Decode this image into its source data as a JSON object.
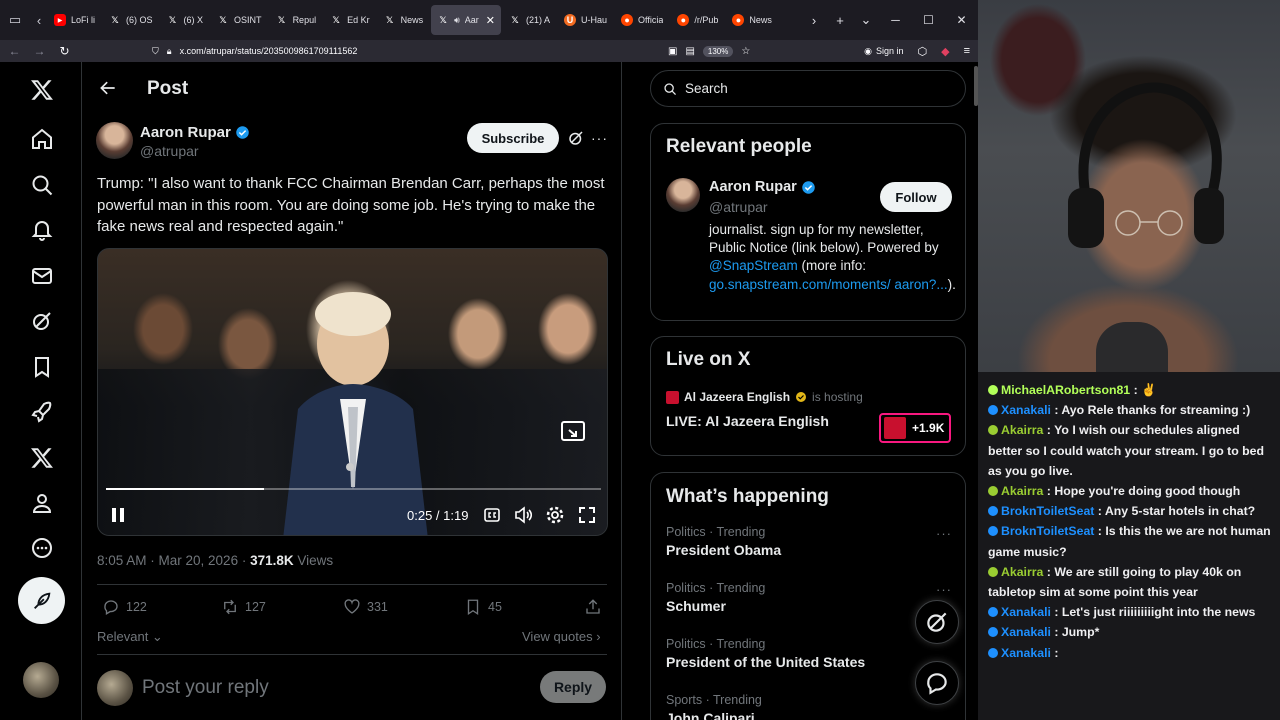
{
  "browser": {
    "tabs": [
      {
        "icon": "youtube-icon",
        "title": "LoFi li",
        "active": false
      },
      {
        "icon": "x-logo-icon",
        "title": "(6) OS",
        "active": false
      },
      {
        "icon": "x-logo-icon",
        "title": "(6) X",
        "active": false
      },
      {
        "icon": "x-logo-icon",
        "title": "OSINT",
        "active": false
      },
      {
        "icon": "x-logo-icon",
        "title": "Repul",
        "active": false
      },
      {
        "icon": "x-logo-icon",
        "title": "Ed Kr",
        "active": false
      },
      {
        "icon": "x-logo-icon",
        "title": "News",
        "active": false
      },
      {
        "icon": "x-logo-icon",
        "title": "Aar",
        "active": true
      },
      {
        "icon": "x-logo-icon",
        "title": "(21) A",
        "active": false
      },
      {
        "icon": "uhaul-icon",
        "title": "U-Hau",
        "active": false
      },
      {
        "icon": "reddit-icon",
        "title": "Officia",
        "active": false
      },
      {
        "icon": "reddit-icon",
        "title": "/r/Pub",
        "active": false
      },
      {
        "icon": "reddit-icon",
        "title": "News",
        "active": false
      }
    ],
    "url": "x.com/atrupar/status/2035009861709111562",
    "zoom": "130%",
    "sign_in": "Sign in"
  },
  "post": {
    "header_title": "Post",
    "author_name": "Aaron Rupar",
    "author_handle": "@atrupar",
    "subscribe_label": "Subscribe",
    "text": "Trump: \"I also want to thank FCC Chairman Brendan Carr, perhaps the most powerful man in this room. You are doing some job. He's trying to make the fake news real and respected again.\"",
    "video": {
      "time": "0:25 / 1:19",
      "progress": 0.32
    },
    "timestamp": "8:05 AM · Mar 20, 2026 · ",
    "views_count": "371.8K",
    "views_label": " Views",
    "replies": "122",
    "reposts": "127",
    "likes": "331",
    "bookmarks": "45",
    "sort_label": "Relevant",
    "view_quotes": "View quotes",
    "reply_placeholder": "Post your reply",
    "reply_button": "Reply"
  },
  "sidebar": {
    "search_placeholder": "Search",
    "relevant_title": "Relevant people",
    "rp_name": "Aaron Rupar",
    "rp_handle": "@atrupar",
    "follow_label": "Follow",
    "rp_bio_1": "journalist. sign up for my newsletter, Public Notice (link below). Powered by ",
    "rp_bio_link1": "@SnapStream",
    "rp_bio_2": " (more info: ",
    "rp_bio_link2": "go.snapstream.com/moments/ aaron?...",
    "rp_bio_3": ").",
    "live_title": "Live on X",
    "live_host_name": "Al Jazeera English",
    "live_host_suffix": "is hosting",
    "live_stream_title": "LIVE: Al Jazeera English",
    "live_listeners": "+1.9K",
    "whats_happening_title": "What’s happening",
    "trends": [
      {
        "category": "Politics · Trending",
        "name": "President Obama"
      },
      {
        "category": "Politics · Trending",
        "name": "Schumer"
      },
      {
        "category": "Politics · Trending",
        "name": "President of the United States"
      },
      {
        "category": "Sports · Trending",
        "name": "John Calipari"
      }
    ]
  },
  "chat": [
    {
      "user": "MichaelARobertson81",
      "color": "#b2ff59",
      "text": ": ✌️"
    },
    {
      "user": "Xanakali",
      "color": "#1e90ff",
      "text": ": Ayo Rele thanks for streaming :)"
    },
    {
      "user": "Akairra",
      "color": "#9acd32",
      "text": ": Yo I wish our schedules aligned better so I could watch your stream. I go to bed as you go live."
    },
    {
      "user": "Akairra",
      "color": "#9acd32",
      "text": ": Hope you're doing good though"
    },
    {
      "user": "BroknToiletSeat",
      "color": "#1e90ff",
      "text": ": Any 5-star hotels in chat?"
    },
    {
      "user": "BroknToiletSeat",
      "color": "#1e90ff",
      "text": ": Is this the we are not human game music?"
    },
    {
      "user": "Akairra",
      "color": "#9acd32",
      "text": ": We are still going to play 40k on tabletop sim at some point this year"
    },
    {
      "user": "Xanakali",
      "color": "#1e90ff",
      "text": ": Let's just riiiiiiiiight into the news"
    },
    {
      "user": "Xanakali",
      "color": "#1e90ff",
      "text": ": Jump*"
    },
    {
      "user": "Xanakali",
      "color": "#1e90ff",
      "text": ": "
    }
  ],
  "colors": {
    "x_blue": "#1d9bf0",
    "border": "#2f3336",
    "muted": "#71767b",
    "live_pink": "#f91880"
  }
}
